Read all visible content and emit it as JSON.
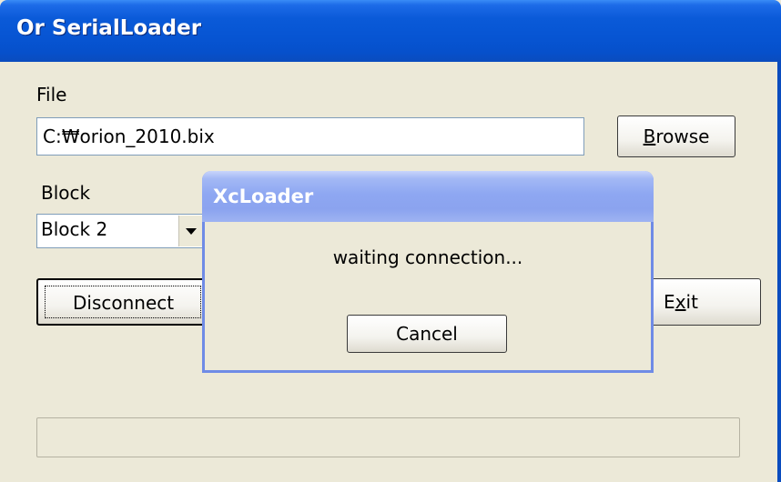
{
  "main_window": {
    "title": "Or SerialLoader",
    "file_label": "File",
    "file_path": "C:₩orion_2010.bix",
    "browse_button": {
      "mnemonic": "B",
      "rest": "rowse"
    },
    "block_label": "Block",
    "block_selected": "Block 2",
    "disconnect_label": "Disconnect",
    "exit_button": {
      "mnemonic": "x",
      "rest": "it"
    },
    "progress": 0
  },
  "dialog": {
    "title": "XcLoader",
    "message": "waiting connection...",
    "cancel_label": "Cancel"
  },
  "colors": {
    "titlebar": "#0755d3",
    "dialog_titlebar": "#8ea7f2",
    "window_face": "#ece9d8"
  }
}
